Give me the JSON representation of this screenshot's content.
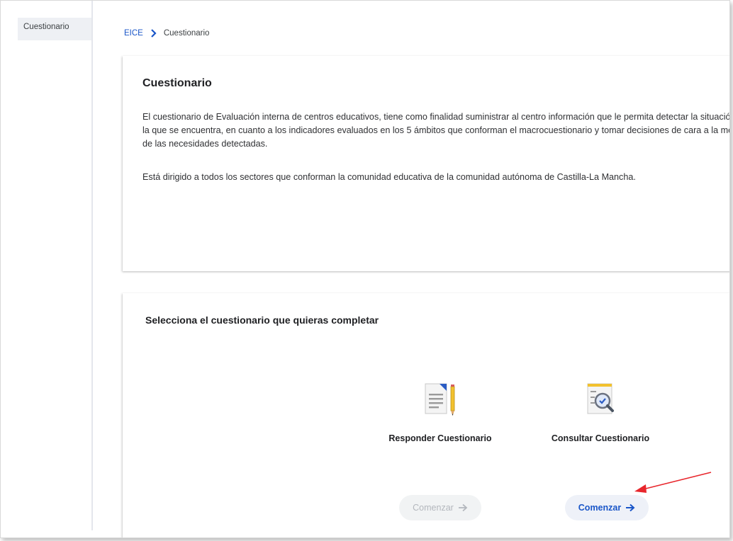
{
  "sidebar": {
    "items": [
      {
        "label": "Cuestionario"
      }
    ]
  },
  "breadcrumb": {
    "root": "EICE",
    "current": "Cuestionario"
  },
  "intro": {
    "title": "Cuestionario",
    "paragraph1": "El cuestionario de Evaluación interna de centros educativos, tiene como finalidad suministrar al centro información que le permita detectar la situación en la que se encuentra, en cuanto a los indicadores evaluados en los 5 ámbitos que conforman el macrocuestionario y tomar decisiones de cara a la mejora de las necesidades detectadas.",
    "paragraph2": "Está dirigido a todos los sectores que conforman la comunidad educativa de la comunidad autónoma de Castilla-La Mancha."
  },
  "selection": {
    "title": "Selecciona el cuestionario que quieras completar",
    "options": [
      {
        "label": "Responder Cuestionario",
        "icon": "document-pencil-icon",
        "button": "Comenzar",
        "enabled": false
      },
      {
        "label": "Consultar Cuestionario",
        "icon": "document-magnifier-icon",
        "button": "Comenzar",
        "enabled": true
      }
    ]
  },
  "colors": {
    "accent": "#1a56c8",
    "annotation": "#e8262c",
    "disabled_text": "#b3b7bd"
  }
}
